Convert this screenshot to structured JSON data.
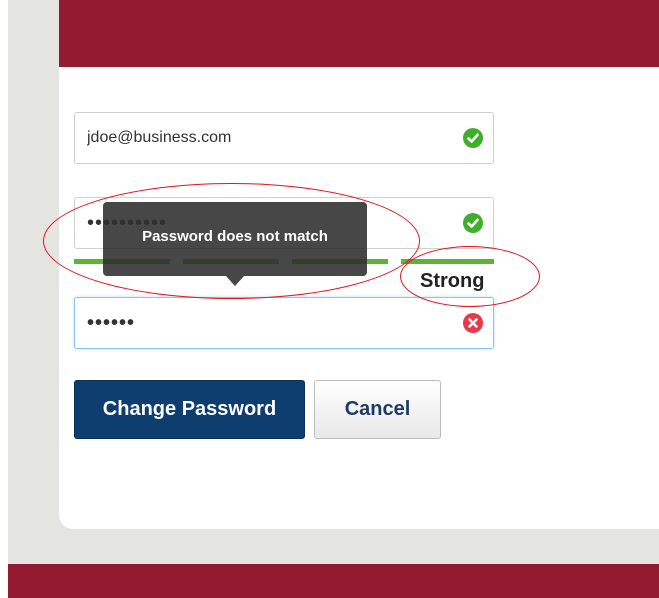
{
  "form": {
    "email": {
      "value": "jdoe@business.com",
      "status": "valid"
    },
    "password": {
      "masked_value": "••••••••••",
      "status": "valid"
    },
    "confirm_password": {
      "masked_value": "••••••",
      "status": "invalid"
    }
  },
  "strength": {
    "label": "Strong",
    "filled_segments": 4,
    "total_segments": 4
  },
  "tooltip": {
    "text": "Password does not match"
  },
  "buttons": {
    "change_password": "Change Password",
    "cancel": "Cancel"
  },
  "colors": {
    "brand": "#941a31",
    "primary_button": "#0e3d70",
    "valid": "#3fae2b",
    "invalid": "#e8394a",
    "strength_bar": "#5cb337",
    "annotation": "#e0141c"
  },
  "icons": {
    "valid": "check-circle-icon",
    "invalid": "x-circle-icon"
  }
}
